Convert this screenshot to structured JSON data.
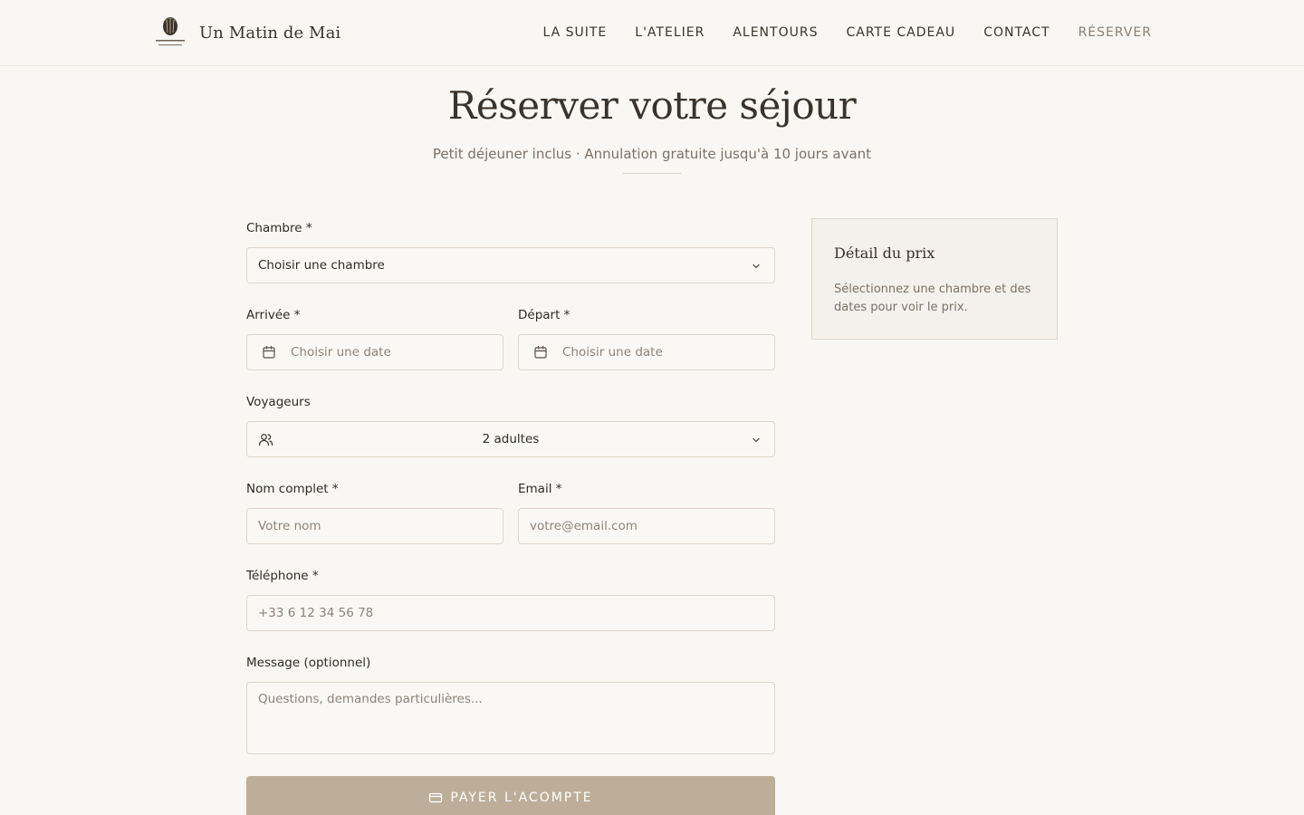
{
  "brand": {
    "name": "Un Matin de Mai",
    "logo_icon": "flower-logo-icon"
  },
  "nav": {
    "items": [
      {
        "label": "LA SUITE"
      },
      {
        "label": "L'ATELIER"
      },
      {
        "label": "ALENTOURS"
      },
      {
        "label": "CARTE CADEAU"
      },
      {
        "label": "CONTACT"
      },
      {
        "label": "RÉSERVER",
        "active": true
      }
    ]
  },
  "hero": {
    "title": "Réserver votre séjour",
    "subtitle": "Petit déjeuner inclus · Annulation gratuite jusqu'à 10 jours avant"
  },
  "form": {
    "room": {
      "label": "Chambre *",
      "value": "Choisir une chambre"
    },
    "arrival": {
      "label": "Arrivée *",
      "value": "Choisir une date"
    },
    "departure": {
      "label": "Départ *",
      "value": "Choisir une date"
    },
    "guests": {
      "label": "Voyageurs",
      "value": "2 adultes"
    },
    "name": {
      "label": "Nom complet *",
      "placeholder": "Votre nom"
    },
    "email": {
      "label": "Email *",
      "placeholder": "votre@email.com"
    },
    "phone": {
      "label": "Téléphone *",
      "placeholder": "+33 6 12 34 56 78"
    },
    "message": {
      "label": "Message (optionnel)",
      "placeholder": "Questions, demandes particulières..."
    },
    "submit_label": "PAYER L'ACOMPTE"
  },
  "price_card": {
    "title": "Détail du prix",
    "hint": "Sélectionnez une chambre et des dates pour voir le prix."
  },
  "colors": {
    "background": "#f9f7f4",
    "accent": "#bcae98",
    "text": "#2f2a24",
    "muted": "#7c7164",
    "border": "#ddd5ca"
  }
}
